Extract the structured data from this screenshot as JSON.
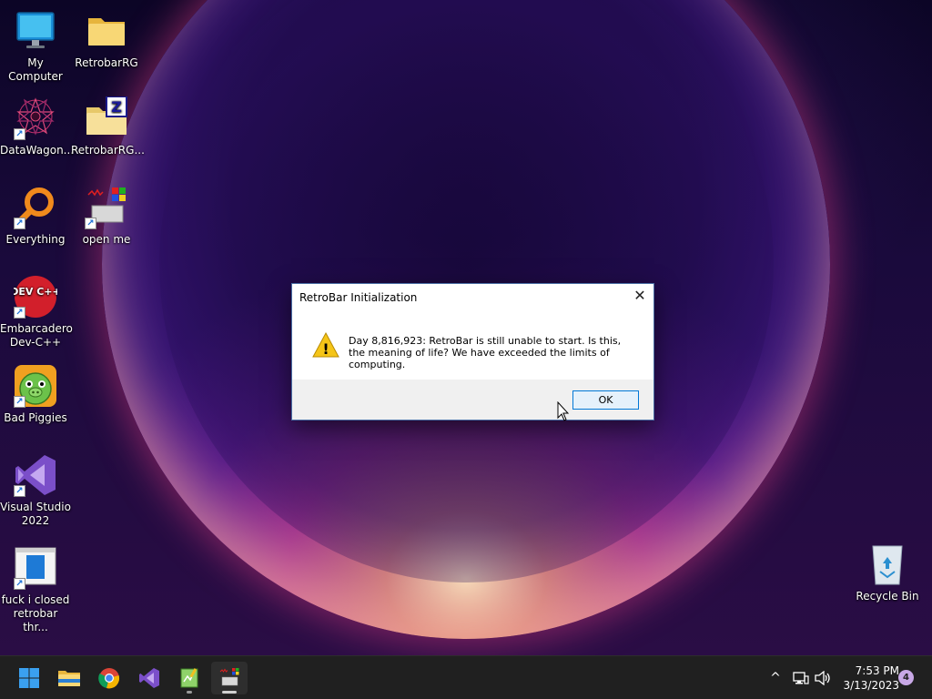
{
  "desktop": {
    "icons": [
      {
        "label": "My Computer"
      },
      {
        "label": "RetrobarRG"
      },
      {
        "label": "DataWagon..."
      },
      {
        "label": "RetrobarRG..."
      },
      {
        "label": "Everything"
      },
      {
        "label": "open me"
      },
      {
        "label": "Embarcadero Dev-C++"
      },
      {
        "label": "Bad Piggies"
      },
      {
        "label": "Visual Studio 2022"
      },
      {
        "label": "fuck i closed retrobar thr..."
      },
      {
        "label": "Recycle Bin"
      }
    ],
    "devcpp_icon_text": "DEV C++"
  },
  "dialog": {
    "title": "RetroBar Initialization",
    "close_glyph": "✕",
    "message": "Day 8,816,923: RetroBar is still unable to start. Is this, the meaning of life? We have exceeded the limits of computing.",
    "ok_label": "OK",
    "warning_glyph": "!"
  },
  "taskbar": {
    "pinned": [
      {
        "name": "start"
      },
      {
        "name": "file-explorer"
      },
      {
        "name": "chrome"
      },
      {
        "name": "visual-studio"
      },
      {
        "name": "notepad"
      },
      {
        "name": "retrobar",
        "active": true
      }
    ],
    "tray": {
      "overflow_glyph": "^",
      "time": "7:53 PM",
      "date": "3/13/2023",
      "notification_count": "4"
    }
  },
  "colors": {
    "taskbar_bg": "#202020",
    "accent": "#0078d7",
    "warning": "#f5c518"
  }
}
